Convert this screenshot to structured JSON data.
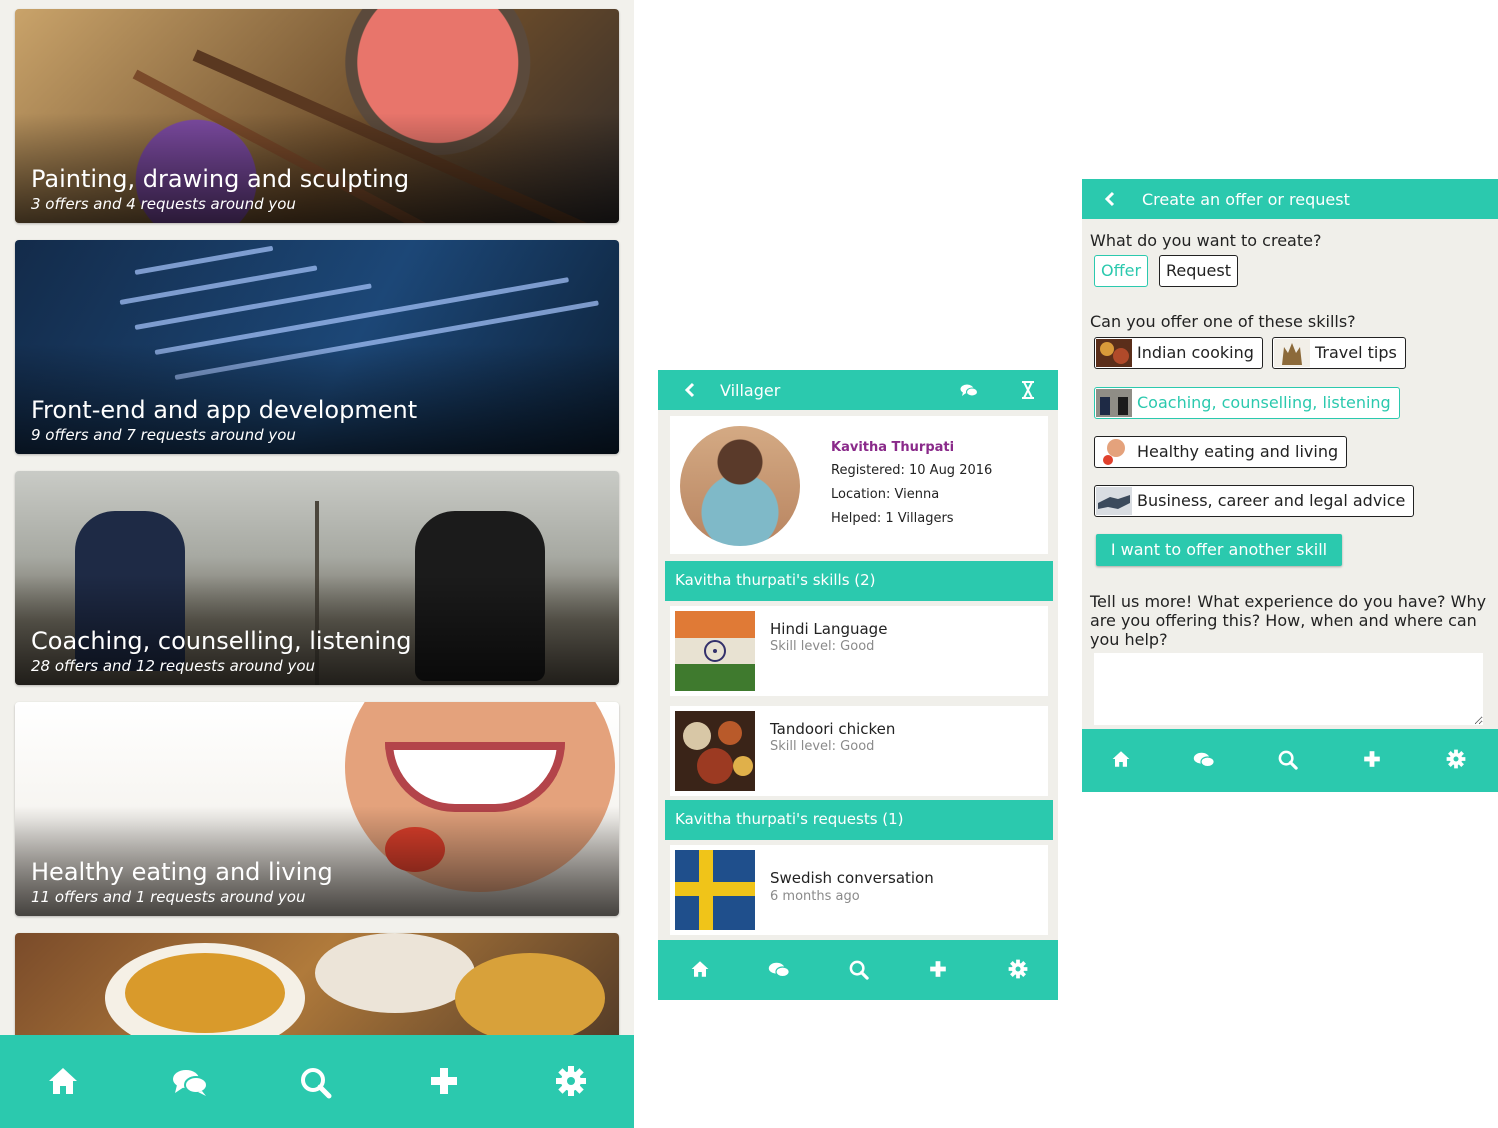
{
  "screen1": {
    "cards": [
      {
        "title": "Painting, drawing and sculpting",
        "subtitle": "3 offers and 4 requests around you"
      },
      {
        "title": "Front-end and app development",
        "subtitle": "9 offers and 7 requests around you"
      },
      {
        "title": "Coaching, counselling, listening",
        "subtitle": "28 offers and 12 requests around you"
      },
      {
        "title": "Healthy eating and living",
        "subtitle": "11 offers and 1 requests around you"
      }
    ],
    "nav": [
      "home-icon",
      "chat-icon",
      "search-icon",
      "plus-icon",
      "gear-icon"
    ]
  },
  "screen2": {
    "header_title": "Villager",
    "profile": {
      "name": "Kavitha Thurpati",
      "registered": "Registered: 10 Aug 2016",
      "location": "Location: Vienna",
      "helped": "Helped: 1 Villagers"
    },
    "skills_header": "Kavitha thurpati's skills (2)",
    "skills": [
      {
        "name": "Hindi Language",
        "meta": "Skill level: Good"
      },
      {
        "name": "Tandoori chicken",
        "meta": "Skill level: Good"
      }
    ],
    "requests_header": "Kavitha thurpati's requests (1)",
    "requests": [
      {
        "name": "Swedish conversation",
        "meta": "6 months ago"
      }
    ]
  },
  "screen3": {
    "header_title": "Create an offer or request",
    "question_create": "What do you want to create?",
    "type_options": [
      {
        "label": "Offer",
        "selected": true
      },
      {
        "label": "Request",
        "selected": false
      }
    ],
    "question_skills": "Can you offer one of these skills?",
    "skills": [
      {
        "label": "Indian cooking",
        "selected": false
      },
      {
        "label": "Travel tips",
        "selected": false
      },
      {
        "label": "Coaching, counselling, listening",
        "selected": true
      },
      {
        "label": "Healthy eating and living",
        "selected": false
      },
      {
        "label": "Business, career and legal advice",
        "selected": false
      }
    ],
    "another_skill_button": "I want to offer another skill",
    "tell_more": "Tell us more! What experience do you have? Why are you offering this? How, when and where can you help?",
    "textarea_value": ""
  },
  "colors": {
    "accent": "#2bc9ae",
    "name_purple": "#8a2a8a"
  }
}
